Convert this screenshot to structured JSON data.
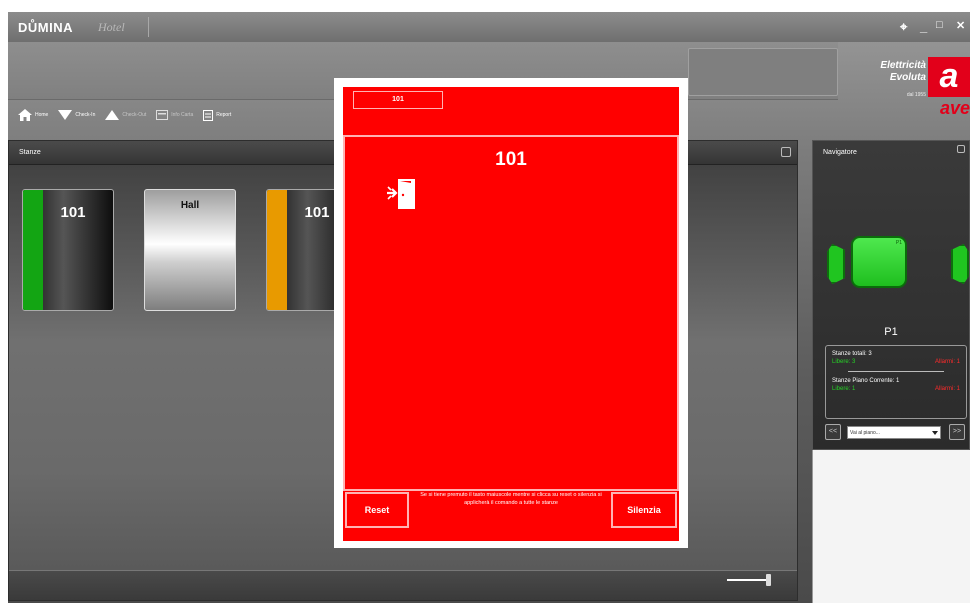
{
  "app": {
    "logo": "DŮMINA",
    "logo_sub": "Hotel",
    "win_pin": "⌖",
    "win_min": "_",
    "win_max": "□",
    "win_close": "✕"
  },
  "brand": {
    "line1": "Elettricità",
    "line2": "Evoluta",
    "since": "dal 1955",
    "badge": "a",
    "name": "ave",
    "color": "#e2001a"
  },
  "toolbar": [
    {
      "label": "Home",
      "icon": "home-icon",
      "dim": false
    },
    {
      "label": "Check-In",
      "icon": "checkin-icon",
      "dim": false
    },
    {
      "label": "Check-Out",
      "icon": "checkout-icon",
      "dim": true
    },
    {
      "label": "Info Carta",
      "icon": "card-icon",
      "dim": true
    },
    {
      "label": "Report",
      "icon": "report-icon",
      "dim": false
    }
  ],
  "stanze": {
    "title": "Stanze",
    "cards": [
      {
        "label": "101",
        "status_color": "#13a513",
        "style": "dark"
      },
      {
        "label": "Hall",
        "status_color": "",
        "style": "hall"
      },
      {
        "label": "101",
        "status_color": "#e89a00",
        "style": "dark"
      }
    ]
  },
  "navigator": {
    "title": "Navigatore",
    "floor_tag": "P1",
    "floor_label": "P1",
    "stats": {
      "total_rooms": "Stanze totali: 3",
      "total_free": "Libere: 3",
      "total_busy": "Allarmi: 1",
      "floor_rooms": "Stanze Piano Corrente: 1",
      "floor_free": "Libere: 1",
      "floor_busy": "Allarmi: 1"
    },
    "prev": "<<",
    "next": ">>",
    "select_value": "Vai al piano..."
  },
  "dialog": {
    "tab": "101",
    "title": "101",
    "icon": "exit-door-icon",
    "reset": "Reset",
    "silence": "Silenzia",
    "note": "Se si tiene premuto il tasto maiuscole mentre si clicca su reset o silenzia si applicherà il comando a tutte le stanze",
    "bg_color": "#ff0000"
  }
}
